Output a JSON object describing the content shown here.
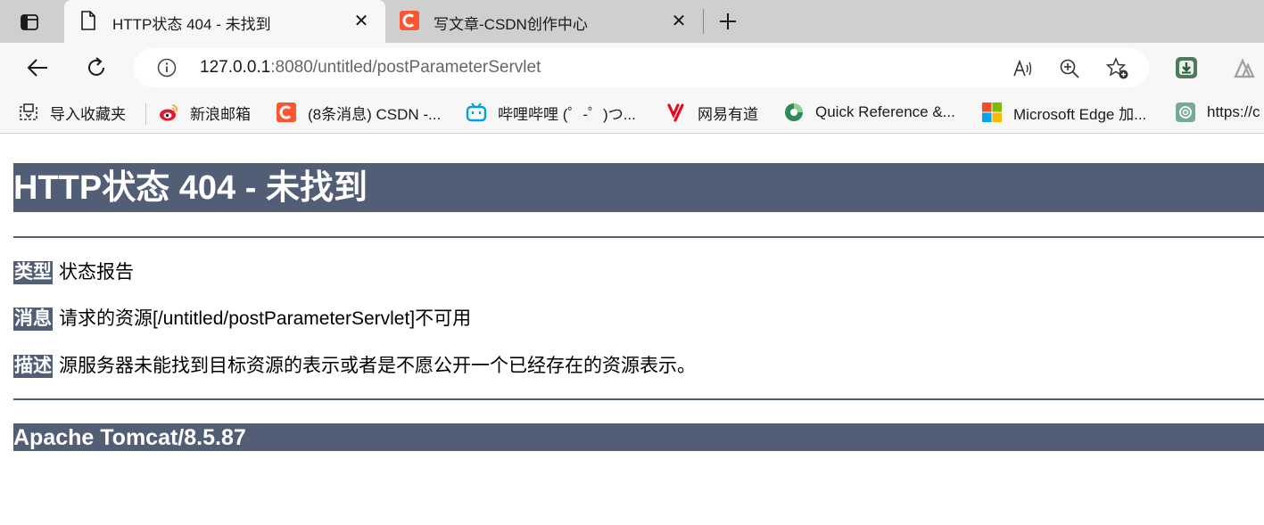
{
  "tabs": [
    {
      "title": "HTTP状态 404 - 未找到",
      "active": true,
      "icon": "page-icon"
    },
    {
      "title": "写文章-CSDN创作中心",
      "active": false,
      "icon": "csdn-icon"
    }
  ],
  "tab_close_glyph": "✕",
  "address": {
    "host": "127.0.0.1",
    "rest": ":8080/untitled/postParameterServlet"
  },
  "bookmarks": [
    {
      "label": "导入收藏夹",
      "icon": "import-favorites-icon"
    },
    {
      "label": "新浪邮箱",
      "icon": "weibo-icon"
    },
    {
      "label": "(8条消息) CSDN -...",
      "icon": "csdn-icon"
    },
    {
      "label": "哔哩哔哩 (゜-゜)つ...",
      "icon": "bilibili-icon"
    },
    {
      "label": "网易有道",
      "icon": "youdao-icon"
    },
    {
      "label": "Quick Reference &...",
      "icon": "quickref-icon"
    },
    {
      "label": "Microsoft Edge 加...",
      "icon": "microsoft-icon"
    },
    {
      "label": "https://c",
      "icon": "chatgpt-icon"
    }
  ],
  "page": {
    "heading": "HTTP状态 404 - 未找到",
    "type_label": "类型",
    "type_value": "状态报告",
    "message_label": "消息",
    "message_value": "请求的资源[/untitled/postParameterServlet]不可用",
    "description_label": "描述",
    "description_value": "源服务器未能找到目标资源的表示或者是不愿公开一个已经存在的资源表示。",
    "footer": "Apache Tomcat/8.5.87"
  },
  "colors": {
    "tomcat_banner": "#525d76",
    "tabstrip": "#cfcfcf",
    "toolbar": "#f7f7f7",
    "csdn": "#fc5531"
  }
}
